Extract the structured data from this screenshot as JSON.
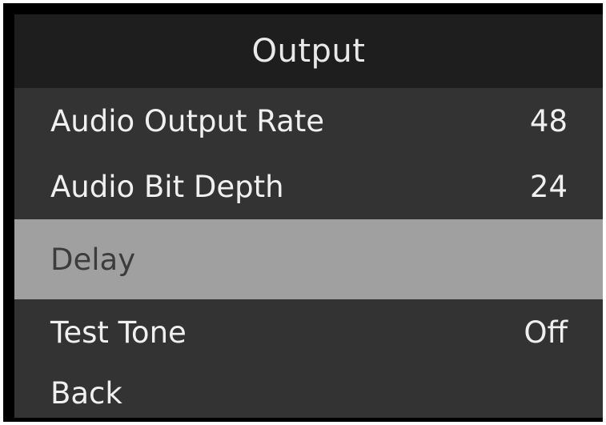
{
  "menu_title": "Output",
  "colors": {
    "background": "#333333",
    "title_bar": "#1e1e1e",
    "selected_row": "#a0a0a0",
    "text": "#f0f0f0",
    "selected_text": "#3c3c3c"
  },
  "items": [
    {
      "label": "Audio Output Rate",
      "value": "48",
      "selected": false
    },
    {
      "label": "Audio Bit Depth",
      "value": "24",
      "selected": false
    },
    {
      "label": "Delay",
      "value": "",
      "selected": true
    },
    {
      "label": "Test Tone",
      "value": "Off",
      "selected": false
    },
    {
      "label": "Back",
      "value": "",
      "selected": false
    }
  ]
}
